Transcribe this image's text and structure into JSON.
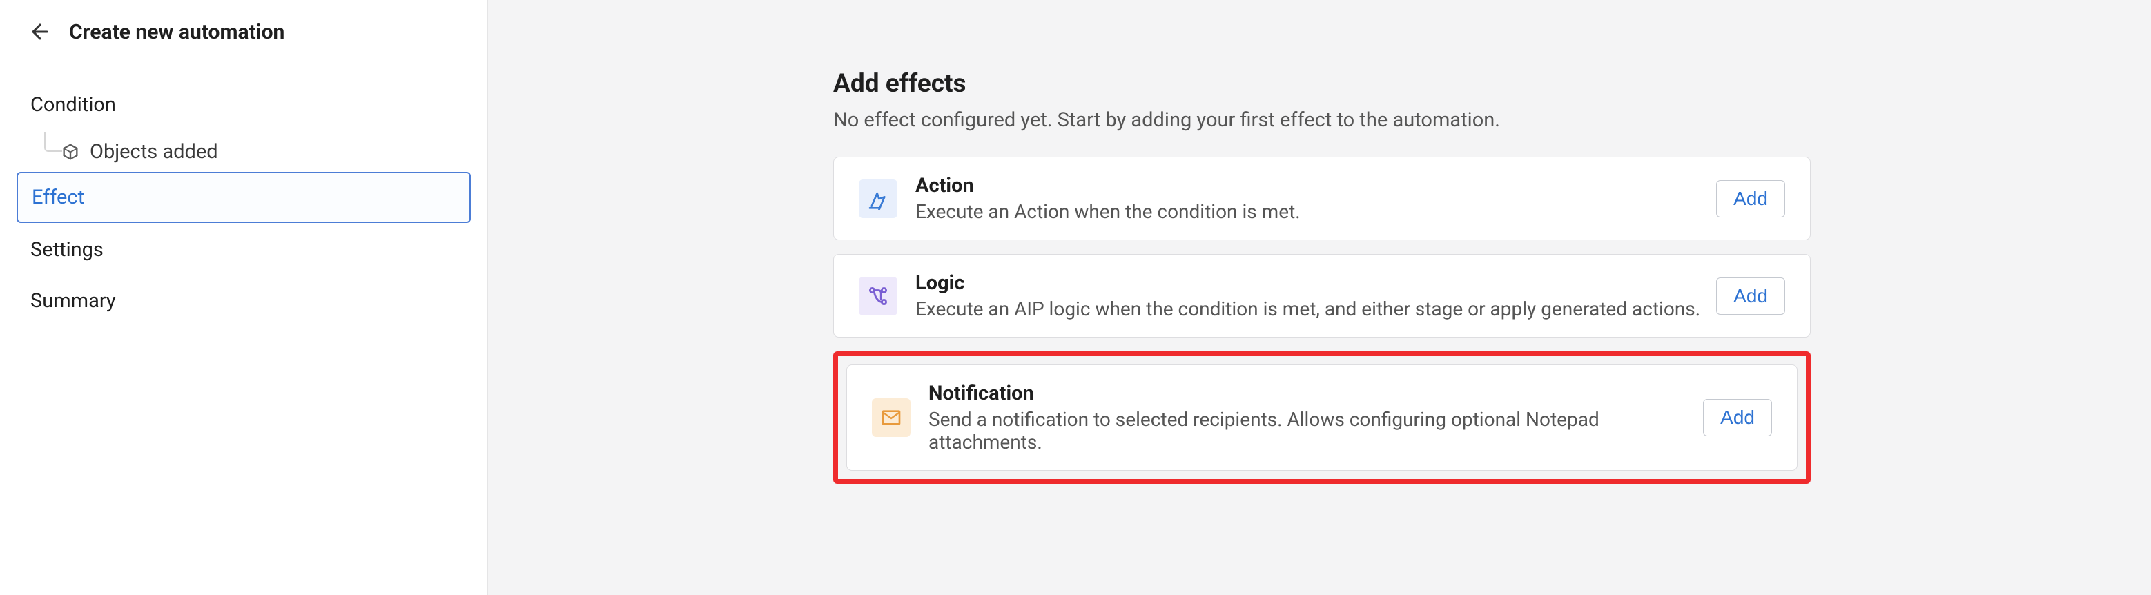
{
  "title": "Create new automation",
  "nav": {
    "condition": "Condition",
    "condition_sub": "Objects added",
    "effect": "Effect",
    "settings": "Settings",
    "summary": "Summary"
  },
  "main": {
    "heading": "Add effects",
    "subtitle": "No effect configured yet. Start by adding your first effect to the automation.",
    "add_label": "Add",
    "cards": {
      "action": {
        "title": "Action",
        "desc": "Execute an Action when the condition is met."
      },
      "logic": {
        "title": "Logic",
        "desc": "Execute an AIP logic when the condition is met, and either stage or apply generated actions."
      },
      "notification": {
        "title": "Notification",
        "desc": "Send a notification to selected recipients. Allows configuring optional Notepad attachments."
      }
    }
  }
}
